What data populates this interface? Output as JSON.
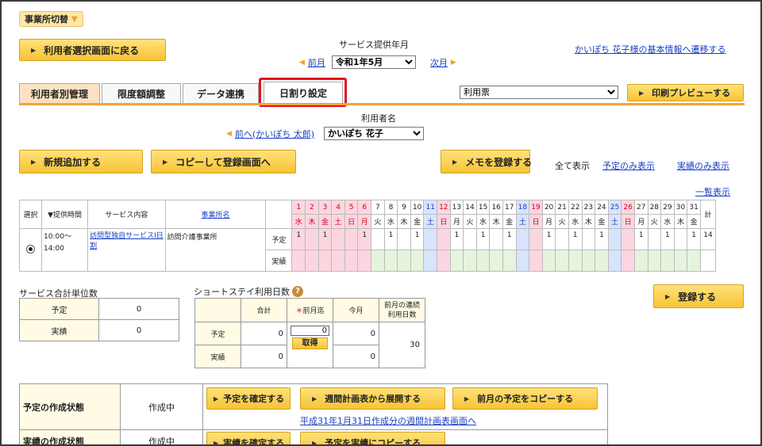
{
  "office_label": "事業所切替",
  "back_button": "利用者選択画面に戻る",
  "service_year_month_label": "サービス提供年月",
  "prev_month": "前月",
  "month_value": "令和1年5月",
  "next_month": "次月",
  "basic_info_link": "かいぽち 花子様の基本情報へ遷移する",
  "tabs": [
    {
      "label": "利用者別管理"
    },
    {
      "label": "限度額調整"
    },
    {
      "label": "データ連携"
    },
    {
      "label": "日割り設定"
    }
  ],
  "report_select": "利用票",
  "print_preview": "印刷プレビューする",
  "user_name_label": "利用者名",
  "prev_user": "前へ(かいぽち 太郎)",
  "user_select": "かいぽち 花子",
  "new_add": "新規追加する",
  "copy_register": "コピーして登録画面へ",
  "memo_register": "メモを登録する",
  "filter_all": "全て表示",
  "filter_plan": "予定のみ表示",
  "filter_actual": "実績のみ表示",
  "list_view": "一覧表示",
  "header": {
    "select": "選択",
    "time": "▼提供時間",
    "service": "サービス内容",
    "office": "事業所名",
    "total": "計"
  },
  "days": [
    "1",
    "2",
    "3",
    "4",
    "5",
    "6",
    "7",
    "8",
    "9",
    "10",
    "11",
    "12",
    "13",
    "14",
    "15",
    "16",
    "17",
    "18",
    "19",
    "20",
    "21",
    "22",
    "23",
    "24",
    "25",
    "26",
    "27",
    "28",
    "29",
    "30",
    "31"
  ],
  "weekdays": [
    "水",
    "木",
    "金",
    "土",
    "日",
    "月",
    "火",
    "水",
    "木",
    "金",
    "土",
    "日",
    "月",
    "火",
    "水",
    "木",
    "金",
    "土",
    "日",
    "月",
    "火",
    "水",
    "木",
    "金",
    "土",
    "日",
    "月",
    "火",
    "水",
    "木",
    "金"
  ],
  "row": {
    "time": "10:00〜 14:00",
    "service": "訪問型独自サービスⅠ日割",
    "office": "訪問介護事業所",
    "plan_label": "予定",
    "actual_label": "実績",
    "plan_values": [
      "1",
      "",
      "1",
      "",
      "",
      "1",
      "",
      "1",
      "",
      "1",
      "",
      "",
      "1",
      "",
      "1",
      "",
      "1",
      "",
      "",
      "1",
      "",
      "1",
      "",
      "1",
      "",
      "",
      "1",
      "",
      "1",
      "",
      "1"
    ],
    "plan_total": "14"
  },
  "units": {
    "title": "サービス合計単位数",
    "plan": "予定",
    "actual": "実績",
    "plan_val": "0",
    "actual_val": "0"
  },
  "short_stay": {
    "title": "ショートステイ利用日数",
    "help": "?",
    "total": "合計",
    "prev_month": "前月迄",
    "this_month": "今月",
    "continuous": "前月の連続利用日数",
    "plan": "予定",
    "actual": "実績",
    "plan_total": "0",
    "plan_prev": "0",
    "plan_this": "0",
    "actual_total": "0",
    "actual_this": "0",
    "continuous_val": "30",
    "fetch": "取得"
  },
  "register": "登録する",
  "status": {
    "plan_label": "予定の作成状態",
    "plan_state": "作成中",
    "confirm_plan": "予定を確定する",
    "expand_weekly": "週間計画表から展開する",
    "copy_prev": "前月の予定をコピーする",
    "weekly_link": "平成31年1月31日作成分の週間計画表画面へ",
    "actual_label": "実績の作成状態",
    "actual_state": "作成中",
    "confirm_actual": "実績を確定する",
    "copy_plan": "予定を実績にコピーする"
  },
  "colors": {
    "accent": "#f2a33c",
    "highlight": "#e0161f",
    "button": "#f7c335"
  }
}
